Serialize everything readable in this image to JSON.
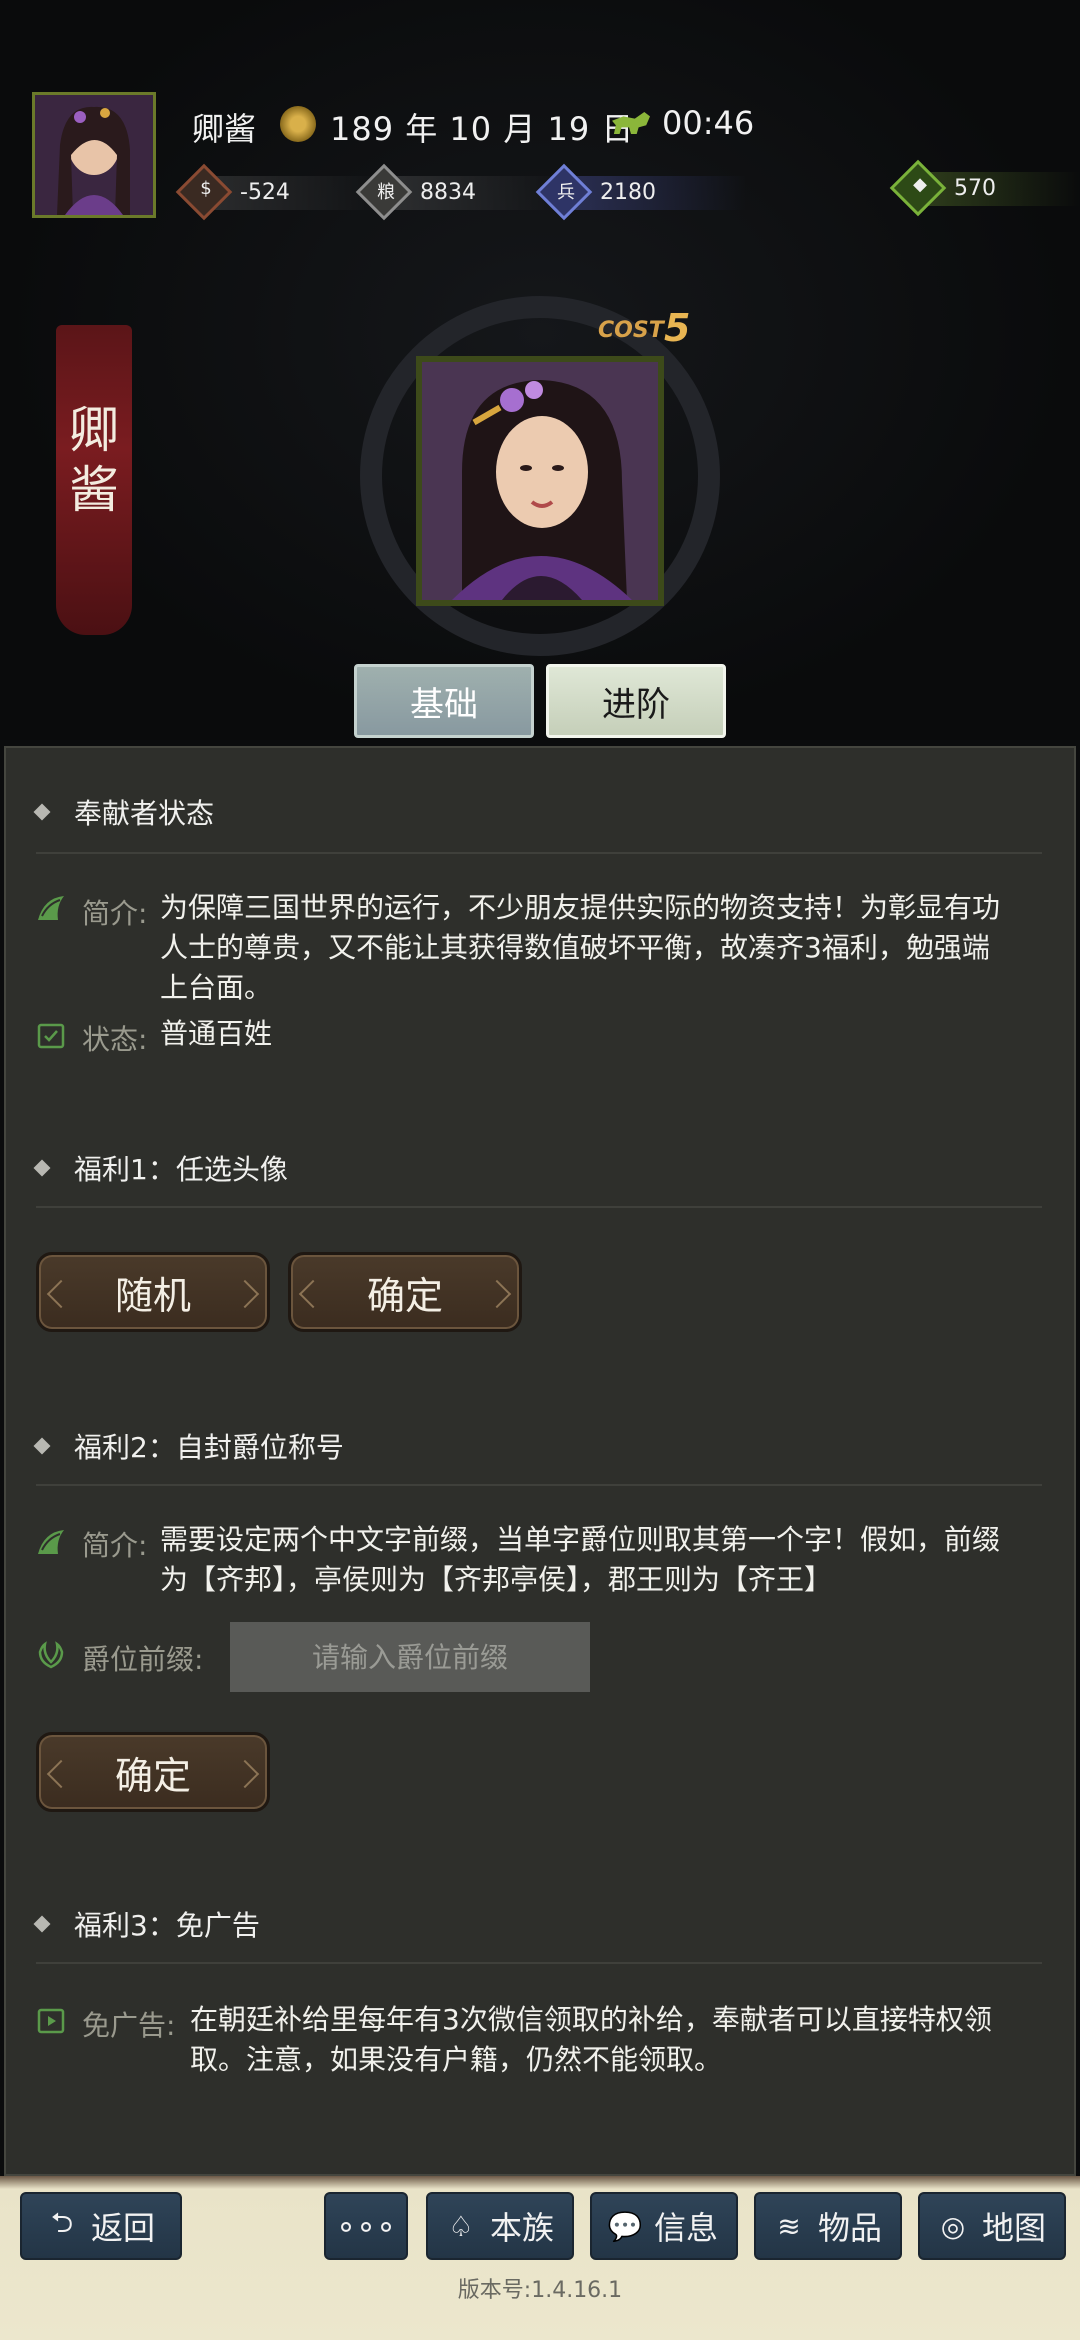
{
  "header": {
    "player_name": "卿酱",
    "date": "189 年 10 月 19 日",
    "time": "00:46",
    "resources": [
      {
        "icon": "coin-icon",
        "glyph": "💰",
        "value": "-524",
        "color": "#8a4a32"
      },
      {
        "icon": "grain-icon",
        "glyph": "粮",
        "value": "8834",
        "color": "#8e8e8e"
      },
      {
        "icon": "soldier-icon",
        "glyph": "兵",
        "value": "2180",
        "color": "#4a5bb0"
      },
      {
        "icon": "gem-bag-icon",
        "glyph": "◆",
        "value": "570",
        "color": "#5f8f2a"
      }
    ]
  },
  "character": {
    "seal_name": "卿\n酱",
    "cost_label": "COST",
    "cost_value": "5"
  },
  "tabs": {
    "basic": "基础",
    "advanced": "进阶"
  },
  "sections": {
    "status": {
      "title": "奉献者状态",
      "intro_label": "简介:",
      "intro_text": "为保障三国世界的运行，不少朋友提供实际的物资支持！为彰显有功人士的尊贵，又不能让其获得数值破坏平衡，故凑齐3福利，勉强端上台面。",
      "state_label": "状态:",
      "state_value": "普通百姓"
    },
    "benefit1": {
      "title": "福利1：任选头像",
      "random_button": "随机",
      "confirm_button": "确定"
    },
    "benefit2": {
      "title": "福利2：自封爵位称号",
      "intro_label": "简介:",
      "intro_text": "需要设定两个中文字前缀，当单字爵位则取其第一个字！假如，前缀为【齐邦】，亭侯则为【齐邦亭侯】，郡王则为【齐王】",
      "prefix_label": "爵位前缀:",
      "prefix_placeholder": "请输入爵位前缀",
      "confirm_button": "确定"
    },
    "benefit3": {
      "title": "福利3：免广告",
      "label": "免广告:",
      "text": "在朝廷补给里每年有3次微信领取的补给，奉献者可以直接特权领取。注意，如果没有户籍，仍然不能领取。"
    }
  },
  "footer": {
    "back": "返回",
    "more": "∘∘∘",
    "clan": "本族",
    "info": "信息",
    "items": "物品",
    "map": "地图",
    "version": "版本号:1.4.16.1"
  }
}
